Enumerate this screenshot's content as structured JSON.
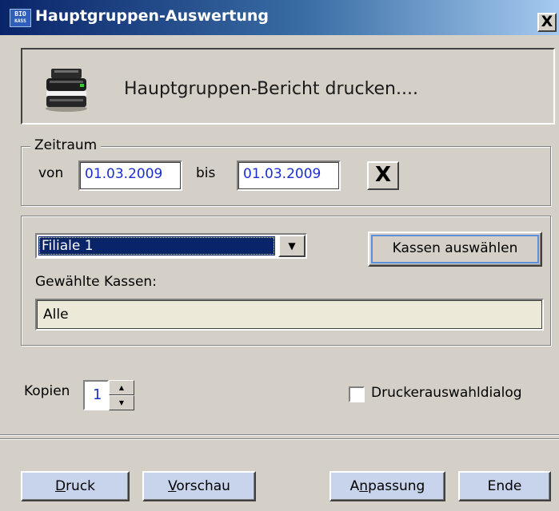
{
  "window": {
    "title": "Hauptgruppen-Auswertung",
    "app_icon_text_top": "BIO",
    "app_icon_text_bottom": "KASS",
    "close_label": "X"
  },
  "header": {
    "text": "Hauptgruppen-Bericht drucken....",
    "icon": "printer-icon"
  },
  "zeitraum": {
    "legend": "Zeitraum",
    "von_label": "von",
    "von_value": "01.03.2009",
    "bis_label": "bis",
    "bis_value": "01.03.2009",
    "clear_label": "X"
  },
  "kassen": {
    "filiale_selected": "Filiale 1",
    "select_button_label": "Kassen auswählen",
    "gewaehlte_label": "Gewählte Kassen:",
    "gewaehlte_value": "Alle"
  },
  "options": {
    "kopien_label": "Kopien",
    "kopien_value": "1",
    "druckerauswahl_label": "Druckerauswahldialog",
    "druckerauswahl_checked": false
  },
  "buttons": {
    "druck_accel": "D",
    "druck_rest": "ruck",
    "vorschau_accel": "V",
    "vorschau_rest": "orschau",
    "anpassung_pre": "A",
    "anpassung_accel": "n",
    "anpassung_rest": "passung",
    "ende_label": "Ende"
  },
  "colors": {
    "title_bar_start": "#0a246a",
    "title_bar_end": "#a6caf0",
    "window_bg": "#d4d0c8",
    "field_text": "#1b2fd0",
    "selection_bg": "#0a246a"
  }
}
